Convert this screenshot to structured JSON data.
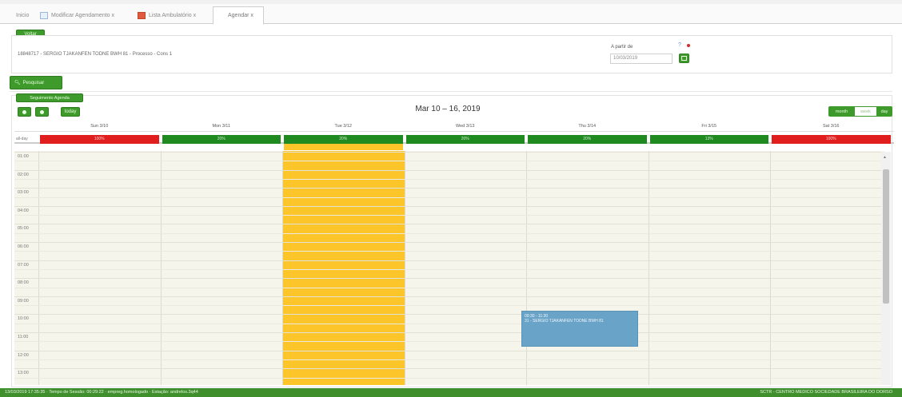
{
  "tabs": [
    {
      "label": "Inicio"
    },
    {
      "label": "Modificar Agendamento x"
    },
    {
      "label": "Lista Ambulatório x"
    },
    {
      "label": "Agendar x"
    }
  ],
  "voltar_label": "Voltar",
  "patient": {
    "info": "18848717 - SERGIO TJAKANFEN TODNE BWH 81 - Processo - Cons 1"
  },
  "start_date": {
    "label": "A partir de",
    "value": "10/03/2019"
  },
  "search_button": "Pesquisar",
  "agenda_button": "Seguimento Agenda",
  "calendar": {
    "title": "Mar 10 – 16, 2019",
    "today_label": "today",
    "views": [
      "month",
      "week",
      "day"
    ],
    "active_view": "week",
    "allday_label": "all-day",
    "days": [
      {
        "label": "Sun 3/10",
        "occupancy": "100%",
        "status_color": "#e01e1e"
      },
      {
        "label": "Mon 3/11",
        "occupancy": "20%",
        "status_color": "#1f8a1f"
      },
      {
        "label": "Tue 3/12",
        "occupancy": "20%",
        "status_color": "#1f8a1f"
      },
      {
        "label": "Wed 3/13",
        "occupancy": "20%",
        "status_color": "#1f8a1f"
      },
      {
        "label": "Thu 3/14",
        "occupancy": "20%",
        "status_color": "#1f8a1f"
      },
      {
        "label": "Fri 3/15",
        "occupancy": "13%",
        "status_color": "#1f8a1f"
      },
      {
        "label": "Sat 3/16",
        "occupancy": "100%",
        "status_color": "#e01e1e"
      }
    ],
    "hours": [
      "01:00",
      "02:00",
      "03:00",
      "04:00",
      "05:00",
      "06:00",
      "07:00",
      "08:00",
      "09:00",
      "10:00",
      "11:00",
      "12:00",
      "13:00"
    ],
    "event": {
      "time": "09:30 - 11:30",
      "title": "31 - SERGIO TJAKANFEN TODNE BWH 81"
    }
  },
  "status": {
    "left": "13/03/2019 17:35:35 · Tempo de Sessão: 00:29:22 · empreg.homologado · Estação: andrelos.3q44",
    "right": "SCTR - CENTRO MEDICO SOCIEDADE BRASILEIRA DO DORSO"
  },
  "colors": {
    "accent_green": "#3d9a2b",
    "today_yellow": "#fcc52a",
    "event_blue": "#6aa3c8"
  }
}
